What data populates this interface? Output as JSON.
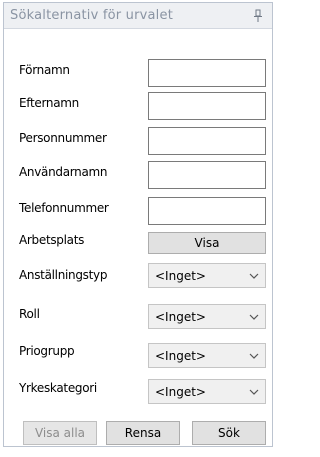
{
  "panel": {
    "title": "Sökalternativ för urvalet"
  },
  "fields": {
    "fornamn_label": "Förnamn",
    "fornamn_value": "",
    "efternamn_label": "Efternamn",
    "efternamn_value": "",
    "personnummer_label": "Personnummer",
    "personnummer_value": "",
    "anvandarnamn_label": "Användarnamn",
    "anvandarnamn_value": "",
    "telefonnummer_label": "Telefonnummer",
    "telefonnummer_value": ""
  },
  "arbetsplats": {
    "label": "Arbetsplats",
    "button_label": "Visa"
  },
  "selects": {
    "anstallningstyp_label": "Anställningstyp",
    "anstallningstyp_value": "<Inget>",
    "roll_label": "Roll",
    "roll_value": "<Inget>",
    "priogrupp_label": "Priogrupp",
    "priogrupp_value": "<Inget>",
    "yrkeskategori_label": "Yrkeskategori",
    "yrkeskategori_value": "<Inget>"
  },
  "actions": {
    "visa_alla_label": "Visa alla",
    "rensa_label": "Rensa",
    "sok_label": "Sök"
  },
  "icons": {
    "pin": "pin-icon",
    "dropdown": "chevron-down-icon"
  }
}
